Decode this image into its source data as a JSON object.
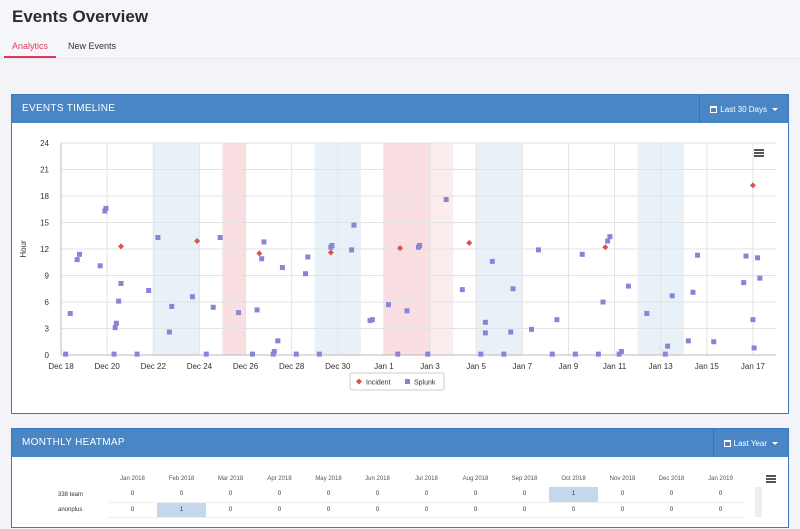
{
  "page": {
    "title": "Events Overview"
  },
  "tabs": [
    {
      "label": "Analytics",
      "active": true
    },
    {
      "label": "New Events",
      "active": false
    }
  ],
  "colors": {
    "header": "#4a86c5",
    "accent": "#e23b5a",
    "incident": "#d9534f",
    "splunk": "#8a84d6",
    "band_blue": "#e9f1f8",
    "band_red": "#f9dfe1"
  },
  "timeline": {
    "title": "EVENTS TIMELINE",
    "range_button": "Last 30 Days",
    "menu_icon": "hamburger-icon",
    "chart_data": {
      "type": "scatter",
      "ylabel": "Hour",
      "ylim": [
        0,
        24
      ],
      "yticks": [
        "0",
        "3",
        "6",
        "9",
        "12",
        "15",
        "18",
        "21",
        "24"
      ],
      "xticks": [
        "Dec 18",
        "Dec 20",
        "Dec 22",
        "Dec 24",
        "Dec 26",
        "Dec 28",
        "Dec 30",
        "Jan 1",
        "Jan 3",
        "Jan 5",
        "Jan 7",
        "Jan 9",
        "Jan 11",
        "Jan 13",
        "Jan 15",
        "Jan 17"
      ],
      "x_start": "Dec 18",
      "x_end": "Jan 18",
      "grid": true,
      "legend_position": "bottom",
      "weekend_bands": [
        {
          "start": 4,
          "end": 6,
          "kind": "weekend"
        },
        {
          "start": 7,
          "end": 8,
          "kind": "holiday"
        },
        {
          "start": 11,
          "end": 13,
          "kind": "weekend"
        },
        {
          "start": 14,
          "end": 16,
          "kind": "holiday"
        },
        {
          "start": 16,
          "end": 17,
          "kind": "holiday-light"
        },
        {
          "start": 18,
          "end": 20,
          "kind": "weekend"
        },
        {
          "start": 25,
          "end": 27,
          "kind": "weekend"
        }
      ],
      "series": [
        {
          "name": "Incident",
          "marker": "diamond",
          "points": [
            [
              2.6,
              12.3
            ],
            [
              5.9,
              12.9
            ],
            [
              8.6,
              11.5
            ],
            [
              11.7,
              11.6
            ],
            [
              14.7,
              12.1
            ],
            [
              17.7,
              12.7
            ],
            [
              23.6,
              12.2
            ],
            [
              30.0,
              19.2
            ]
          ]
        },
        {
          "name": "Splunk",
          "marker": "square",
          "points": [
            [
              0.2,
              0.1
            ],
            [
              0.4,
              4.7
            ],
            [
              0.7,
              10.8
            ],
            [
              0.8,
              11.4
            ],
            [
              1.7,
              10.1
            ],
            [
              1.9,
              16.3
            ],
            [
              1.95,
              16.6
            ],
            [
              2.3,
              0.1
            ],
            [
              2.35,
              3.1
            ],
            [
              2.4,
              3.6
            ],
            [
              2.5,
              6.1
            ],
            [
              2.6,
              8.1
            ],
            [
              3.3,
              0.1
            ],
            [
              3.8,
              7.3
            ],
            [
              4.2,
              13.3
            ],
            [
              4.7,
              2.6
            ],
            [
              4.8,
              5.5
            ],
            [
              5.7,
              6.6
            ],
            [
              6.3,
              0.1
            ],
            [
              6.6,
              5.4
            ],
            [
              6.9,
              13.3
            ],
            [
              7.7,
              4.8
            ],
            [
              8.3,
              0.1
            ],
            [
              8.5,
              5.1
            ],
            [
              8.7,
              10.9
            ],
            [
              8.8,
              12.8
            ],
            [
              9.2,
              0.1
            ],
            [
              9.25,
              0.4
            ],
            [
              9.4,
              1.6
            ],
            [
              9.6,
              9.9
            ],
            [
              10.2,
              0.1
            ],
            [
              10.6,
              9.2
            ],
            [
              10.7,
              11.1
            ],
            [
              11.2,
              0.1
            ],
            [
              11.7,
              12.2
            ],
            [
              11.75,
              12.4
            ],
            [
              12.6,
              11.9
            ],
            [
              12.7,
              14.7
            ],
            [
              13.4,
              3.9
            ],
            [
              13.5,
              4.0
            ],
            [
              14.2,
              5.7
            ],
            [
              14.6,
              0.1
            ],
            [
              15.0,
              5.0
            ],
            [
              15.5,
              12.2
            ],
            [
              15.55,
              12.4
            ],
            [
              15.9,
              0.1
            ],
            [
              16.7,
              17.6
            ],
            [
              17.4,
              7.4
            ],
            [
              18.2,
              0.1
            ],
            [
              18.4,
              3.7
            ],
            [
              18.4,
              2.5
            ],
            [
              18.7,
              10.6
            ],
            [
              19.2,
              0.1
            ],
            [
              19.5,
              2.6
            ],
            [
              19.6,
              7.5
            ],
            [
              20.4,
              2.9
            ],
            [
              20.7,
              11.9
            ],
            [
              21.3,
              0.1
            ],
            [
              21.5,
              4.0
            ],
            [
              22.3,
              0.1
            ],
            [
              22.6,
              11.4
            ],
            [
              23.3,
              0.1
            ],
            [
              23.5,
              6.0
            ],
            [
              23.7,
              12.9
            ],
            [
              23.8,
              13.4
            ],
            [
              24.2,
              0.1
            ],
            [
              24.3,
              0.4
            ],
            [
              24.6,
              7.8
            ],
            [
              25.4,
              4.7
            ],
            [
              26.2,
              0.1
            ],
            [
              26.3,
              1.0
            ],
            [
              26.5,
              6.7
            ],
            [
              27.2,
              1.6
            ],
            [
              27.4,
              7.1
            ],
            [
              27.6,
              11.3
            ],
            [
              28.3,
              1.5
            ],
            [
              29.6,
              8.2
            ],
            [
              29.7,
              11.2
            ],
            [
              30.0,
              4.0
            ],
            [
              30.05,
              0.8
            ],
            [
              30.2,
              11.0
            ],
            [
              30.3,
              8.7
            ]
          ]
        }
      ]
    }
  },
  "heatmap": {
    "title": "MONTHLY HEATMAP",
    "range_button": "Last Year",
    "menu_icon": "hamburger-icon",
    "columns": [
      "Jan 2018",
      "Feb 2018",
      "Mar 2018",
      "Apr 2018",
      "May 2018",
      "Jun 2018",
      "Jul 2018",
      "Aug 2018",
      "Sep 2018",
      "Oct 2018",
      "Nov 2018",
      "Dec 2018",
      "Jan 2019"
    ],
    "rows": [
      {
        "label": "338 team",
        "values": [
          "0",
          "0",
          "0",
          "0",
          "0",
          "0",
          "0",
          "0",
          "0",
          "1",
          "0",
          "0",
          "0"
        ],
        "highlight": [
          9
        ]
      },
      {
        "label": "anonplus",
        "values": [
          "0",
          "1",
          "0",
          "0",
          "0",
          "0",
          "0",
          "0",
          "0",
          "0",
          "0",
          "0",
          "0"
        ],
        "highlight": [
          1
        ]
      }
    ]
  }
}
